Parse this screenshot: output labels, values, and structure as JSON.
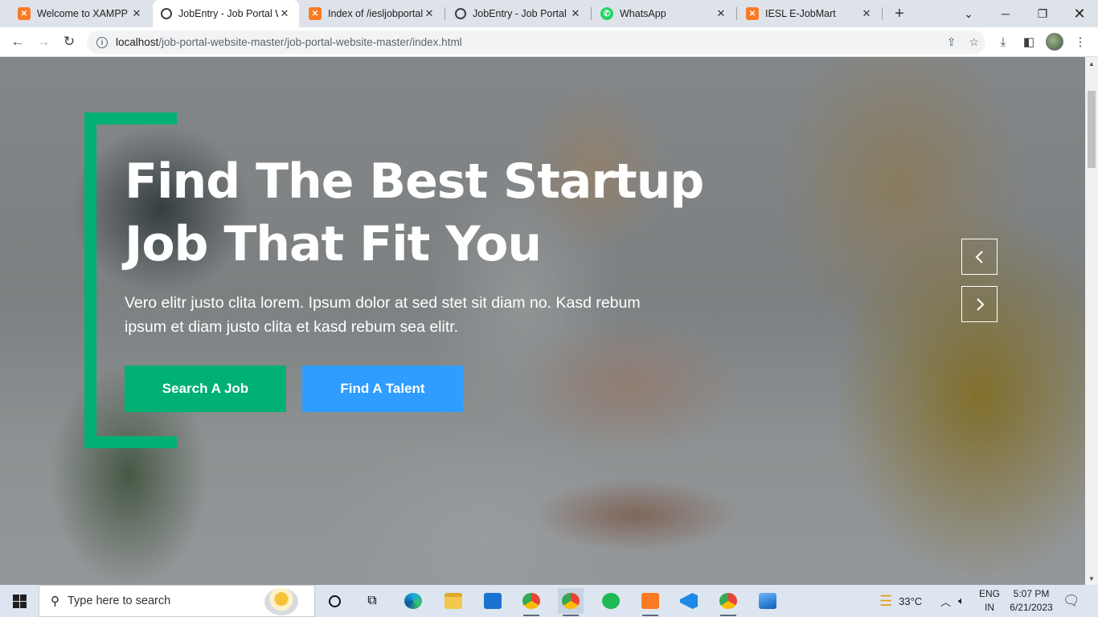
{
  "browser": {
    "tabs": [
      {
        "label": "Welcome to XAMPP",
        "icon": "xampp-icon",
        "active": false
      },
      {
        "label": "JobEntry - Job Portal W",
        "icon": "globe-icon",
        "active": true
      },
      {
        "label": "Index of /iesljobportal",
        "icon": "xampp-icon",
        "active": false
      },
      {
        "label": "JobEntry - Job Portal W",
        "icon": "globe-icon",
        "active": false
      },
      {
        "label": "WhatsApp",
        "icon": "whatsapp-icon",
        "active": false
      },
      {
        "label": "IESL E-JobMart",
        "icon": "xampp-icon",
        "active": false
      }
    ],
    "new_tab_symbol": "+",
    "address": {
      "host": "localhost",
      "path": "/job-portal-website-master/job-portal-website-master/index.html"
    }
  },
  "hero": {
    "title_line1": "Find The Best Startup",
    "title_line2": "Job That Fit You",
    "text": "Vero elitr justo clita lorem. Ipsum dolor at sed stet sit diam no. Kasd rebum ipsum et diam justo clita et kasd rebum sea elitr.",
    "primary_button": "Search A Job",
    "secondary_button": "Find A Talent",
    "accent_color": "#00b074",
    "secondary_color": "#2f9dff"
  },
  "taskbar": {
    "search_placeholder": "Type here to search",
    "weather": "33°C",
    "lang_line1": "ENG",
    "lang_line2": "IN",
    "time": "5:07 PM",
    "date": "6/21/2023"
  }
}
